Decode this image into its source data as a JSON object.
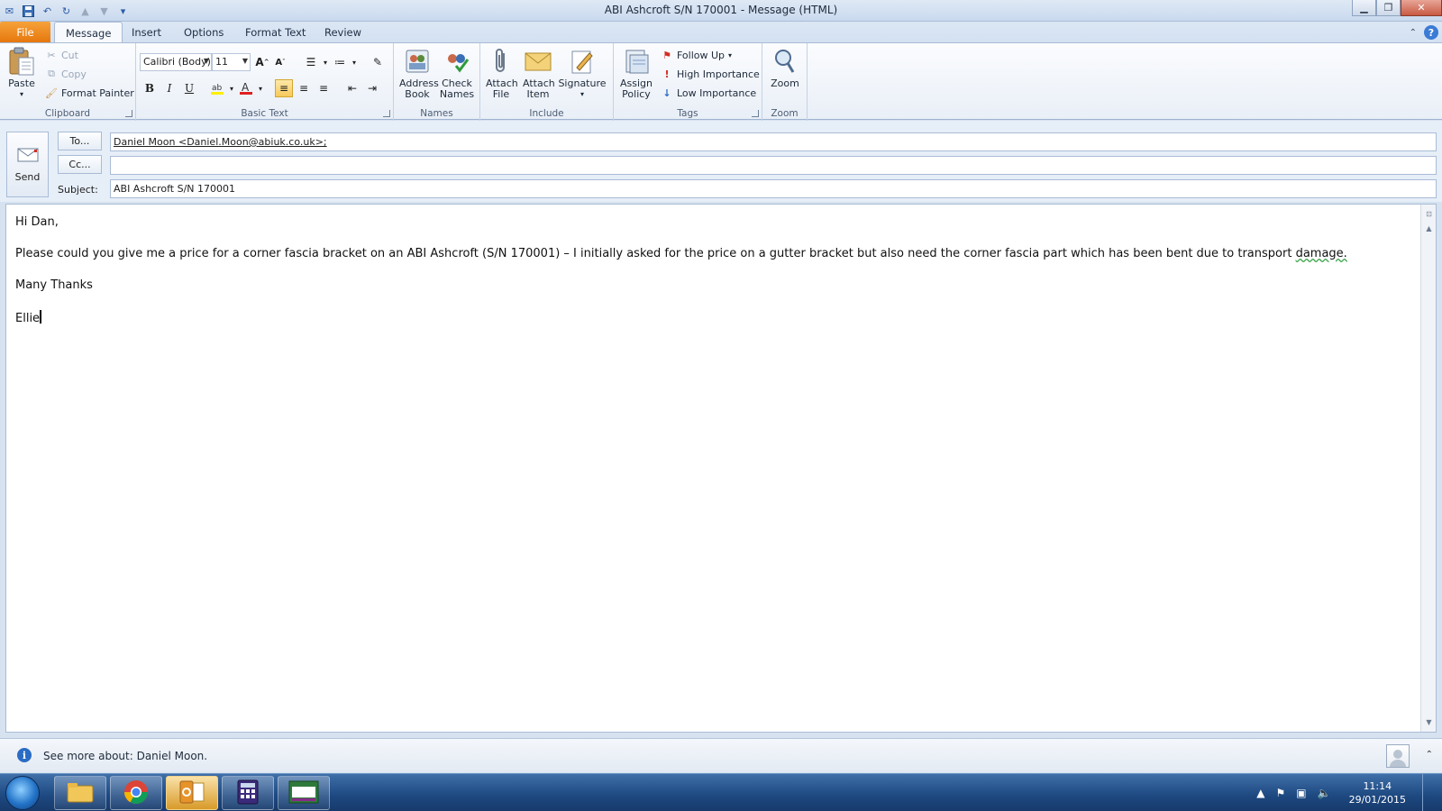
{
  "window": {
    "title": "ABI Ashcroft S/N 170001  -  Message (HTML)"
  },
  "tabs": [
    {
      "label": "File"
    },
    {
      "label": "Message"
    },
    {
      "label": "Insert"
    },
    {
      "label": "Options"
    },
    {
      "label": "Format Text"
    },
    {
      "label": "Review"
    }
  ],
  "ribbon": {
    "clipboard": {
      "label": "Clipboard",
      "paste": "Paste",
      "cut": "Cut",
      "copy": "Copy",
      "format_painter": "Format Painter"
    },
    "basic_text": {
      "label": "Basic Text",
      "font": "Calibri (Body)",
      "size": "11",
      "bold": "B",
      "italic": "I",
      "underline": "U"
    },
    "names": {
      "label": "Names",
      "address_book": "Address Book",
      "check_names": "Check Names"
    },
    "include": {
      "label": "Include",
      "attach_file": "Attach File",
      "attach_item": "Attach Item",
      "signature": "Signature"
    },
    "tags": {
      "label": "Tags",
      "assign_policy": "Assign Policy",
      "follow_up": "Follow Up",
      "high_importance": "High Importance",
      "low_importance": "Low Importance"
    },
    "zoom": {
      "label": "Zoom",
      "zoom": "Zoom"
    }
  },
  "compose": {
    "send": "Send",
    "to_button": "To...",
    "cc_button": "Cc...",
    "subject_label": "Subject:",
    "to_value": "Daniel Moon <Daniel.Moon@abiuk.co.uk>;",
    "cc_value": "",
    "subject_value": "ABI Ashcroft S/N 170001"
  },
  "body": {
    "greeting": "Hi Dan,",
    "paragraph_main": "Please could you give me a price for a corner fascia bracket on an ABI Ashcroft (S/N 170001) – I initially asked for the price on a gutter bracket but also need the corner fascia part which has been bent due to transport ",
    "paragraph_tail": "damage.",
    "closing": "Many Thanks",
    "signature": "Ellie"
  },
  "people_pane": {
    "text": "See more about: Daniel Moon."
  },
  "taskbar": {
    "apps": [
      "file-explorer",
      "chrome",
      "outlook",
      "calculator-app",
      "sage"
    ],
    "time": "11:14",
    "date": "29/01/2015"
  },
  "colors": {
    "file_tab": "#e5760c",
    "accent": "#2a6cc4"
  }
}
